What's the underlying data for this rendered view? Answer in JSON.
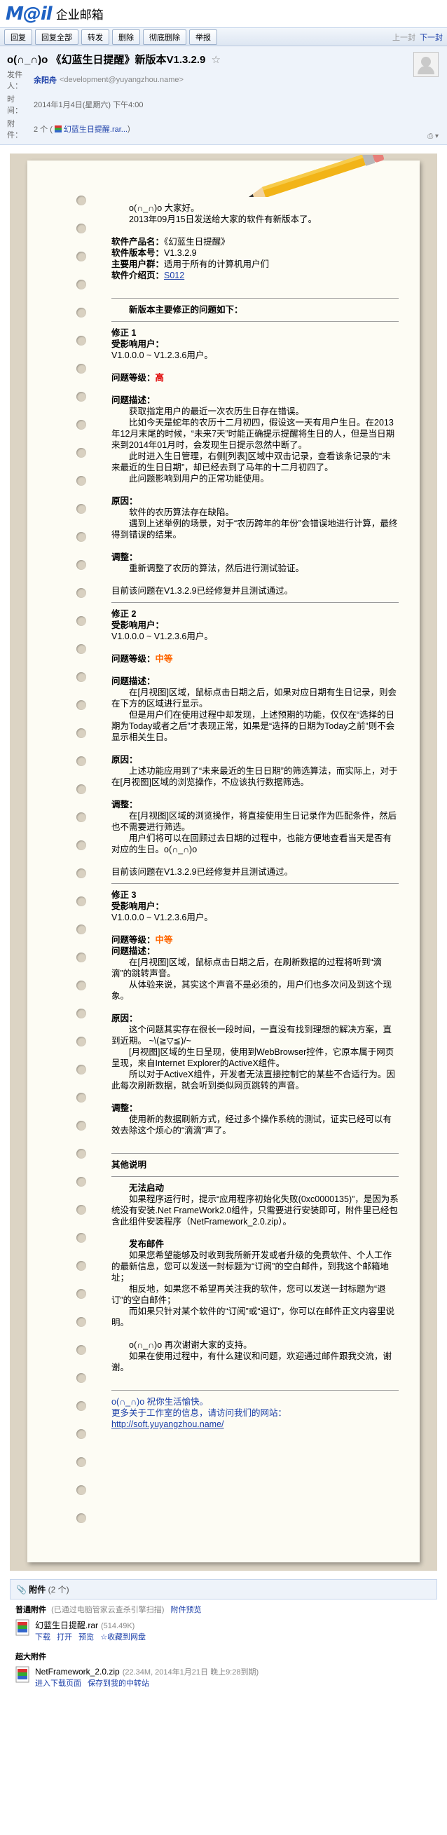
{
  "brand": {
    "logo": "M@il",
    "logo_sub": "企业邮箱"
  },
  "toolbar": {
    "buttons": [
      "回复",
      "回复全部",
      "转发",
      "删除",
      "彻底删除",
      "举报"
    ],
    "prev": "上一封",
    "next": "下一封"
  },
  "header": {
    "subject": "o(∩_∩)o 《幻蓝生日提醒》新版本V1.3.2.9",
    "star": "☆",
    "from_label": "发件人：",
    "from_name": "余阳舟",
    "from_email": "<development@yuyangzhou.name>",
    "time_label": "时　间：",
    "time": "2014年1月4日(星期六) 下午4:00",
    "attach_label": "附　件：",
    "attach_count": "2 个 (",
    "attach_name": "幻蓝生日提醒.rar...",
    "attach_close": ")"
  },
  "body": {
    "greeting": "o(∩_∩)o  大家好。",
    "intro": "2013年09月15日发送给大家的软件有新版本了。",
    "product_name_label": "软件产品名：",
    "product_name": "《幻蓝生日提醒》",
    "version_label": "软件版本号：",
    "version": "V1.3.2.9",
    "users_label": "主要用户群：",
    "users": "适用于所有的计算机用户们",
    "page_label": "软件介绍页：",
    "page_link": "S012",
    "main_title": "新版本主要修正的问题如下：",
    "fix1": {
      "title": "修正 1",
      "affected_label": "受影响用户：",
      "affected": "V1.0.0.0 ~ V1.2.3.6用户。",
      "level_label": "问题等级：",
      "level": "高",
      "desc_label": "问题描述：",
      "d1": "获取指定用户的最近一次农历生日存在错误。",
      "d2": "比如今天是蛇年的农历十二月初四，假设这一天有用户生日。在2013年12月末尾的时候，“未来7天”时能正确提示提醒将生日的人，但是当日期来到2014年01月时，会发现生日提示忽然中断了。",
      "d3": "此时进入生日管理，右侧[列表]区域中双击记录，查看该条记录的“未来最近的生日日期”，却已经去到了马年的十二月初四了。",
      "d4": "此问题影响到用户的正常功能使用。",
      "reason_label": "原因：",
      "r1": "软件的农历算法存在缺陷。",
      "r2": "遇到上述举例的场景，对于“农历跨年的年份”会错误地进行计算，最终得到错误的结果。",
      "fix_label": "调整：",
      "f1": "重新调整了农历的算法，然后进行测试验证。",
      "status": "目前该问题在V1.3.2.9已经修复并且测试通过。"
    },
    "fix2": {
      "title": "修正 2",
      "affected_label": "受影响用户：",
      "affected": "V1.0.0.0 ~ V1.2.3.6用户。",
      "level_label": "问题等级：",
      "level": "中等",
      "desc_label": "问题描述：",
      "d1": "在[月视图]区域，鼠标点击日期之后，如果对应日期有生日记录，则会在下方的区域进行显示。",
      "d2": "但是用户们在使用过程中却发现，上述预期的功能，仅仅在“选择的日期为Today或者之后”才表现正常，如果是“选择的日期为Today之前”则不会显示相关生日。",
      "reason_label": "原因：",
      "r1": "上述功能应用到了“未来最近的生日日期”的筛选算法，而实际上，对于在[月视图]区域的浏览操作，不应该执行数据筛选。",
      "fix_label": "调整：",
      "f1": "在[月视图]区域的浏览操作，将直接使用生日记录作为匹配条件，然后也不需要进行筛选。",
      "f2": "用户们将可以在回顾过去日期的过程中，也能方便地查看当天是否有对应的生日。o(∩_∩)o",
      "status": "目前该问题在V1.3.2.9已经修复并且测试通过。"
    },
    "fix3": {
      "title": "修正 3",
      "affected_label": "受影响用户：",
      "affected": "V1.0.0.0 ~ V1.2.3.6用户。",
      "level_label": "问题等级：",
      "level": "中等",
      "desc_label": "问题描述：",
      "d1": "在[月视图]区域，鼠标点击日期之后，在刷新数据的过程将听到“滴滴”的跳转声音。",
      "d2": "从体验来说，其实这个声音不是必须的，用户们也多次问及到这个现象。",
      "reason_label": "原因：",
      "r1": "这个问题其实存在很长一段时间，一直没有找到理想的解决方案，直到近期。 ~\\(≧▽≦)/~",
      "r2": "[月视图]区域的生日呈现，使用到WebBrowser控件，它原本属于网页呈现，来自Internet Explorer的ActiveX组件。",
      "r3": "所以对于ActiveX组件，开发者无法直接控制它的某些不合适行为。因此每次刷新数据，就会听到类似网页跳转的声音。",
      "fix_label": "调整：",
      "f1": "使用新的数据刷新方式，经过多个操作系统的测试，证实已经可以有效去除这个烦心的“滴滴”声了。"
    },
    "other_title": "其他说明",
    "launch_title": "无法启动",
    "launch_text": "如果程序运行时，提示“应用程序初始化失败(0xc0000135)”，是因为系统没有安装.Net FrameWork2.0组件，只需要进行安装即可，附件里已经包含此组件安装程序（NetFramework_2.0.zip）。",
    "mail_title": "发布邮件",
    "mail_1": "如果您希望能够及时收到我所新开发或者升级的免费软件、个人工作的最新信息，您可以发送一封标题为“订阅”的空白邮件，到我这个邮箱地址；",
    "mail_2": "相反地，如果您不希望再关注我的软件，您可以发送一封标题为“退订”的空白邮件；",
    "mail_3": "而如果只针对某个软件的“订阅”或“退订”，你可以在邮件正文内容里说明。",
    "thanks_1": "o(∩_∩)o 再次谢谢大家的支持。",
    "thanks_2": "如果在使用过程中，有什么建议和问题，欢迎通过邮件跟我交流，谢谢。",
    "sign_1": "o(∩_∩)o  祝你生活愉快。",
    "sign_2": "更多关于工作室的信息，请访问我们的网站：",
    "sign_link": "http://soft.yuyangzhou.name/"
  },
  "attachments": {
    "head": "附件",
    "head_count": "(2 个)",
    "normal_title": "普通附件",
    "normal_note": "(已通过电脑管家云查杀引擎扫描)",
    "normal_preview": "附件预览",
    "file1_name": "幻蓝生日提醒.rar",
    "file1_size": "(514.49K)",
    "file1_actions": [
      "下载",
      "打开",
      "预览",
      "收藏到网盘"
    ],
    "super_title": "超大附件",
    "file2_name": "NetFramework_2.0.zip",
    "file2_size": "(22.34M, 2014年1月21日 晚上9:28到期)",
    "file2_actions": [
      "进入下载页面",
      "保存到我的中转站"
    ]
  }
}
